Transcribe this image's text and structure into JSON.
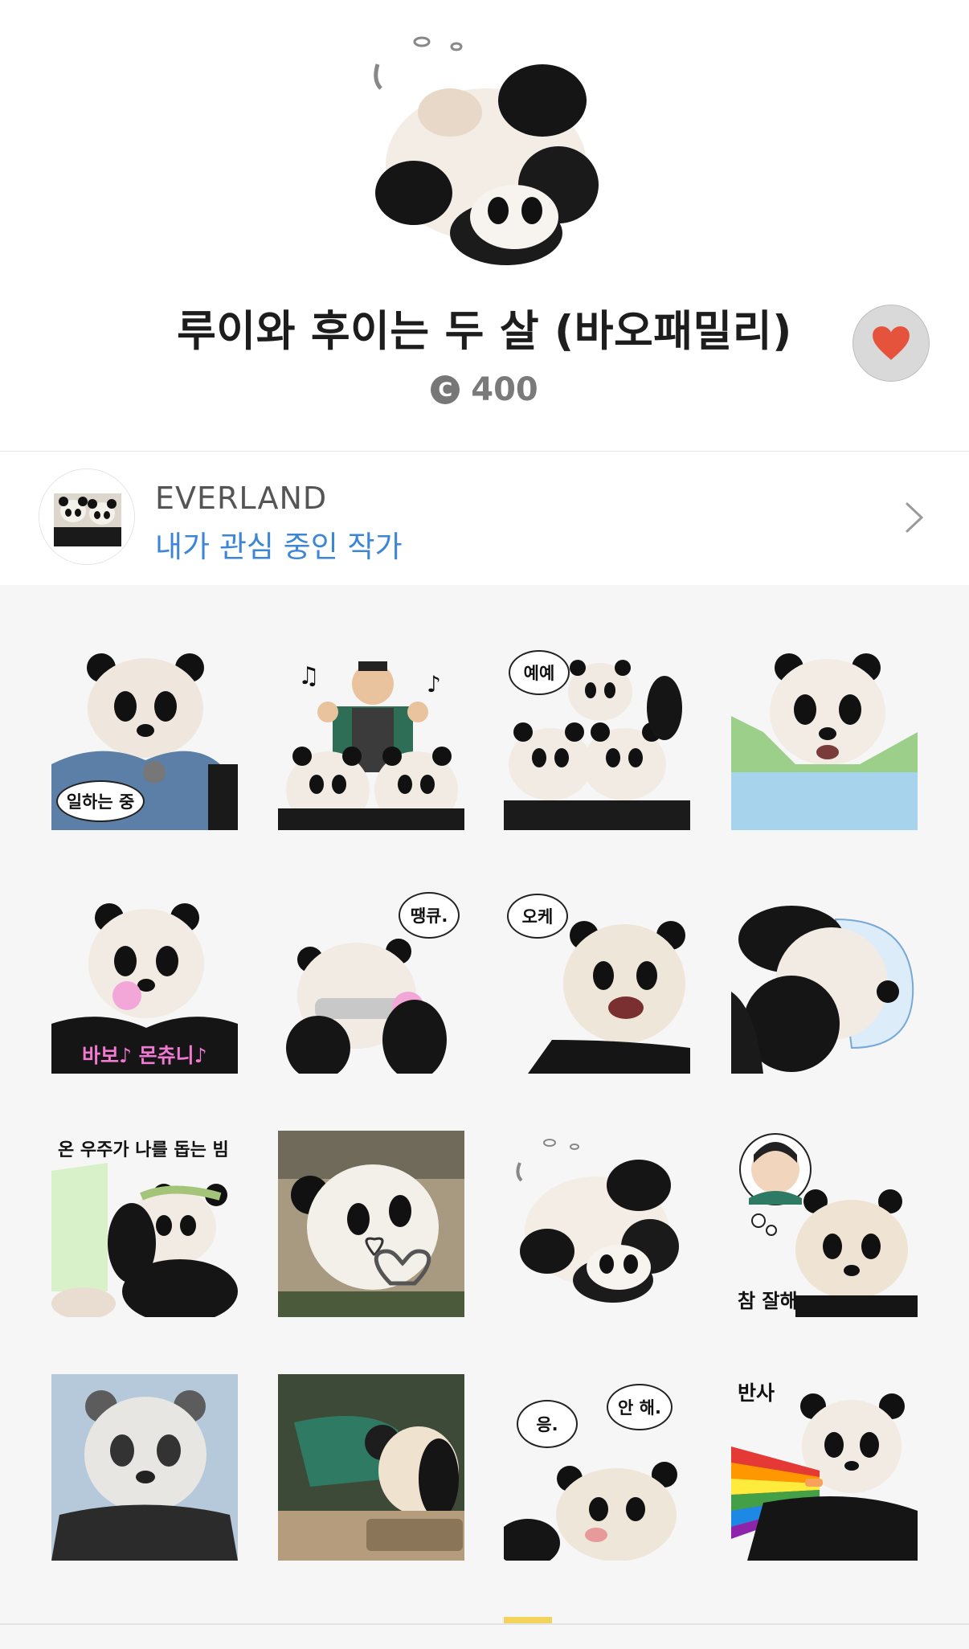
{
  "product": {
    "title": "루이와 후이는 두 살 (바오패밀리)",
    "price": "400",
    "coin_symbol": "C",
    "liked": true
  },
  "author": {
    "name": "EVERLAND",
    "subtitle": "내가 관심 중인 작가"
  },
  "stickers": [
    {
      "caption": "일하는 중"
    },
    {
      "caption": ""
    },
    {
      "caption": "예예"
    },
    {
      "caption": ""
    },
    {
      "caption": "바보♪ 몬츄니♪"
    },
    {
      "caption": "땡큐."
    },
    {
      "caption": "오케"
    },
    {
      "caption": ""
    },
    {
      "caption": "온 우주가 나를 돕는 빔"
    },
    {
      "caption": ""
    },
    {
      "caption": ""
    },
    {
      "caption": "참 잘해"
    },
    {
      "caption": ""
    },
    {
      "caption": ""
    },
    {
      "caption": "응.",
      "caption2": "안 해."
    },
    {
      "caption": "반사"
    }
  ],
  "colors": {
    "accent_blue": "#3d86d6",
    "heart": "#e5533d",
    "grid_background": "#f6f6f6"
  },
  "icons": [
    "coin-icon",
    "heart-icon",
    "chevron-right-icon"
  ]
}
